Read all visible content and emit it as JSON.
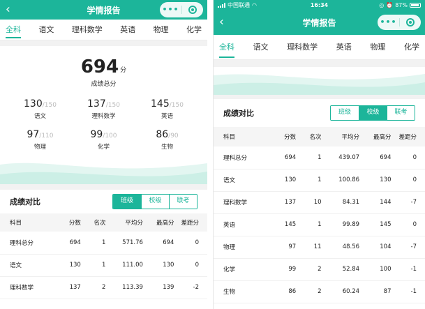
{
  "left": {
    "header": {
      "title": "学情报告"
    },
    "tabs": [
      {
        "label": "全科",
        "active": true
      },
      {
        "label": "语文",
        "active": false
      },
      {
        "label": "理科数学",
        "active": false
      },
      {
        "label": "英语",
        "active": false
      },
      {
        "label": "物理",
        "active": false
      },
      {
        "label": "化学",
        "active": false
      }
    ],
    "summary": {
      "total_score": "694",
      "unit": "分",
      "label": "成绩总分",
      "subjects": [
        {
          "score": "130",
          "max": "/150",
          "name": "语文"
        },
        {
          "score": "137",
          "max": "/150",
          "name": "理科数学"
        },
        {
          "score": "145",
          "max": "/150",
          "name": "英语"
        },
        {
          "score": "97",
          "max": "/110",
          "name": "物理"
        },
        {
          "score": "99",
          "max": "/100",
          "name": "化学"
        },
        {
          "score": "86",
          "max": "/90",
          "name": "生物"
        }
      ]
    },
    "comparison": {
      "title": "成绩对比",
      "segments": [
        {
          "label": "班级",
          "active": true
        },
        {
          "label": "校级",
          "active": false
        },
        {
          "label": "联考",
          "active": false
        }
      ],
      "columns": [
        "科目",
        "分数",
        "名次",
        "平均分",
        "最高分",
        "差距分"
      ],
      "rows": [
        [
          "理科总分",
          "694",
          "1",
          "571.76",
          "694",
          "0"
        ],
        [
          "语文",
          "130",
          "1",
          "111.00",
          "130",
          "0"
        ],
        [
          "理科数学",
          "137",
          "2",
          "113.39",
          "139",
          "-2"
        ]
      ]
    }
  },
  "right": {
    "status_bar": {
      "carrier": "中国联通",
      "time": "16:34",
      "battery": "87%"
    },
    "header": {
      "title": "学情报告"
    },
    "tabs": [
      {
        "label": "全科",
        "active": true
      },
      {
        "label": "语文",
        "active": false
      },
      {
        "label": "理科数学",
        "active": false
      },
      {
        "label": "英语",
        "active": false
      },
      {
        "label": "物理",
        "active": false
      },
      {
        "label": "化学",
        "active": false
      }
    ],
    "comparison": {
      "title": "成绩对比",
      "segments": [
        {
          "label": "班级",
          "active": false
        },
        {
          "label": "校级",
          "active": true
        },
        {
          "label": "联考",
          "active": false
        }
      ],
      "columns": [
        "科目",
        "分数",
        "名次",
        "平均分",
        "最高分",
        "差距分"
      ],
      "rows": [
        [
          "理科总分",
          "694",
          "1",
          "439.07",
          "694",
          "0"
        ],
        [
          "语文",
          "130",
          "1",
          "100.86",
          "130",
          "0"
        ],
        [
          "理科数学",
          "137",
          "10",
          "84.31",
          "144",
          "-7"
        ],
        [
          "英语",
          "145",
          "1",
          "99.89",
          "145",
          "0"
        ],
        [
          "物理",
          "97",
          "11",
          "48.56",
          "104",
          "-7"
        ],
        [
          "化学",
          "99",
          "2",
          "52.84",
          "100",
          "-1"
        ],
        [
          "生物",
          "86",
          "2",
          "60.24",
          "87",
          "-1"
        ]
      ]
    }
  },
  "icons": {
    "back": "chevron-left-icon",
    "more": "more-dots-icon",
    "close": "target-circle-icon",
    "wifi": "wifi-icon",
    "alarm": "alarm-icon",
    "battery": "battery-icon"
  },
  "colors": {
    "accent": "#1cb59a",
    "wave_light": "#e3f6f1",
    "wave_mid": "#ccefe6"
  }
}
